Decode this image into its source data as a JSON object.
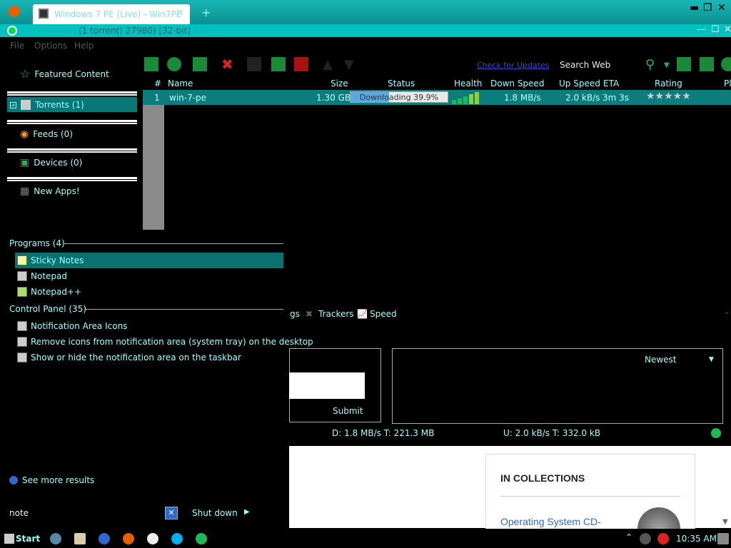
{
  "browser": {
    "tab_title": "Windows 7 PE (Live) - Win7PE",
    "new_tab": "+"
  },
  "app": {
    "title": "(1 torrent) 27980) [32-bit]"
  },
  "menu": {
    "file": "File",
    "options": "Options",
    "help": "Help"
  },
  "toolbar": {
    "link": "Check for Updates",
    "search_label": "Search Web"
  },
  "sidebar": {
    "featured": "Featured Content",
    "torrents": "Torrents (1)",
    "feeds": "Feeds (0)",
    "devices": "Devices (0)",
    "new_apps": "New Apps!"
  },
  "table": {
    "headers": {
      "num": "#",
      "name": "Name",
      "size": "Size",
      "status": "Status",
      "health": "Health",
      "down": "Down Speed",
      "up": "Up Speed",
      "eta": "ETA",
      "rating": "Rating",
      "pl": "Pl"
    },
    "row": {
      "num": "1",
      "name": "win-7-pe",
      "size": "1.30 GB",
      "status": "Downloading 39.9%",
      "progress": 0.399,
      "down": "1.8 MB/s",
      "up": "2.0 kB/s",
      "eta": "3m 3s",
      "rating": "★★★★★"
    }
  },
  "start_menu": {
    "programs_head": "Programs (4)",
    "programs": [
      "Sticky Notes",
      "Notepad",
      "Notepad++"
    ],
    "control_head": "Control Panel (35)",
    "control": [
      "Notification Area Icons",
      "Remove icons from notification area (system tray) on the desktop",
      "Show or hide the notification area on the taskbar"
    ],
    "see_more": "See more results",
    "search_text": "note",
    "shutdown": "Shut down"
  },
  "detail": {
    "tab_gs": "gs",
    "tab_trackers": "Trackers",
    "tab_speed": "Speed",
    "submit": "Submit",
    "newest": "Newest",
    "status_down": "D: 1.8 MB/s T: 221.3 MB",
    "status_up": "U: 2.0 kB/s T: 332.0 kB"
  },
  "web": {
    "collections_title": "IN COLLECTIONS",
    "collection_link": "Operating System CD-"
  },
  "taskbar": {
    "start": "Start",
    "clock": "10:35 AM"
  },
  "colors": {
    "accent": "#00c0c0",
    "selection": "#0b7d7d",
    "text": "#99ffff"
  }
}
